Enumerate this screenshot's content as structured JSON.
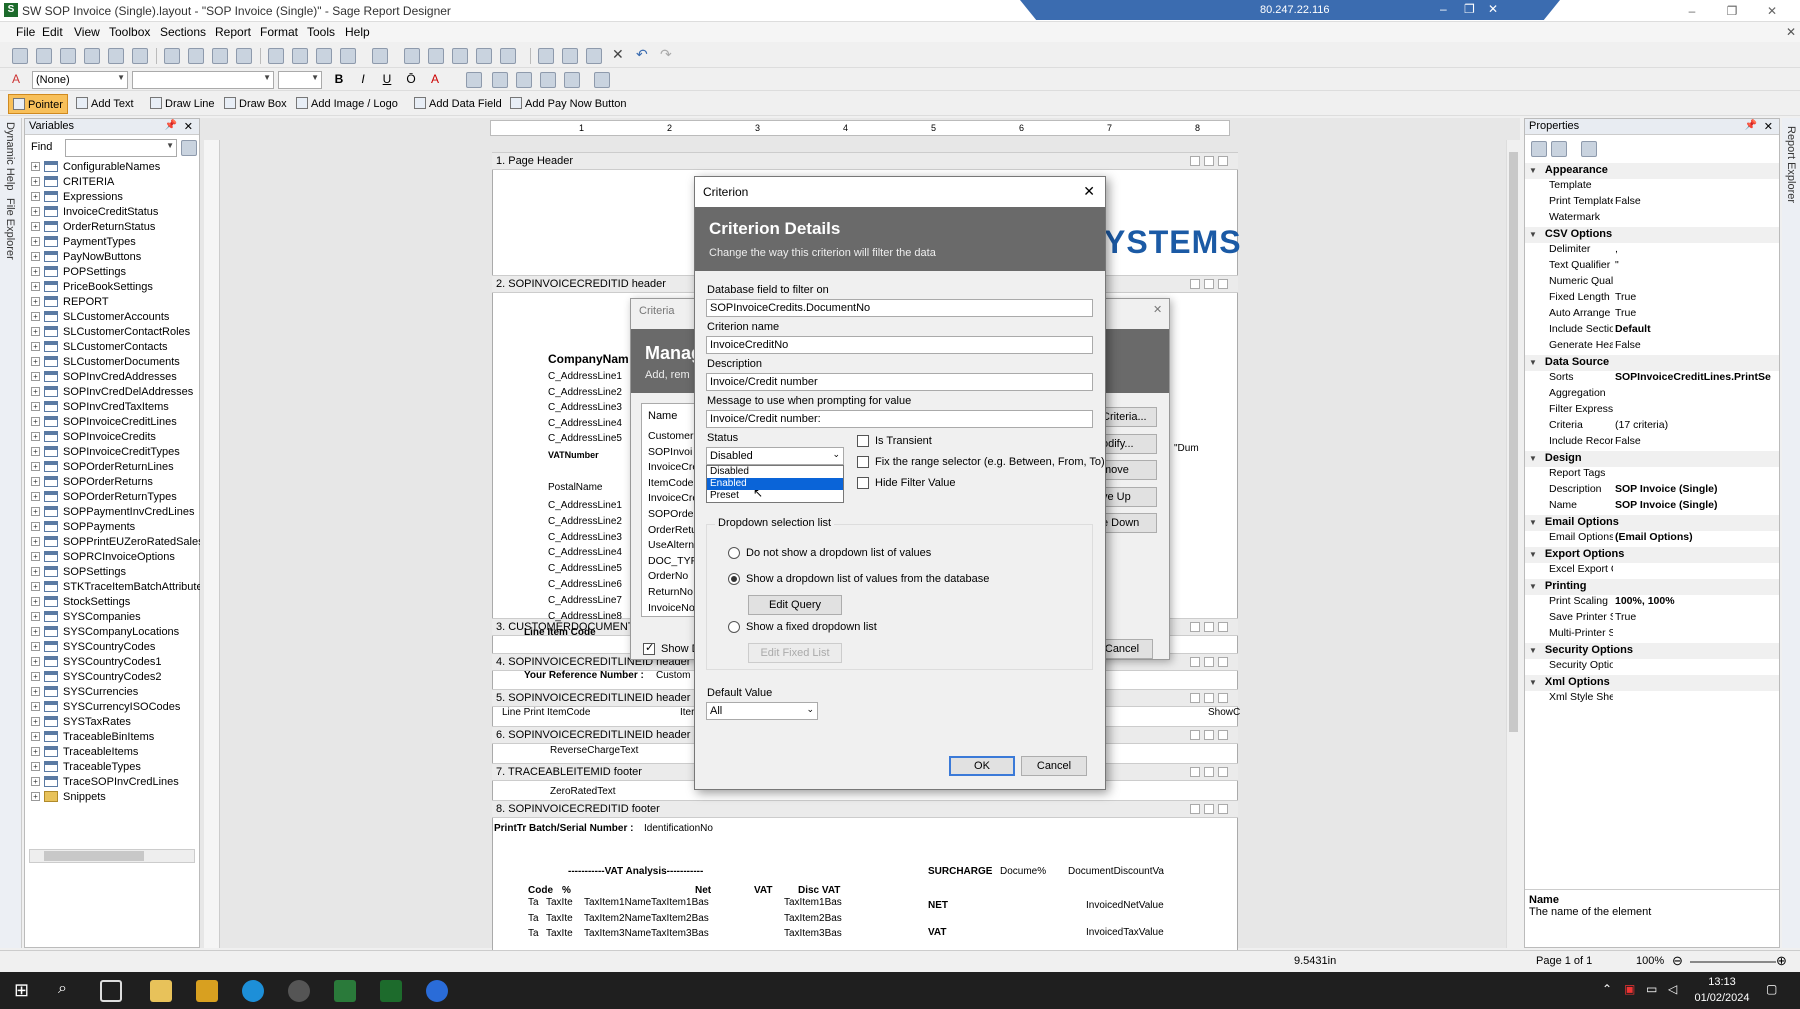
{
  "window": {
    "title": "SW SOP Invoice (Single).layout - \"SOP Invoice (Single)\" - Sage Report Designer",
    "remote_ip": "80.247.22.116"
  },
  "menu": [
    "File",
    "Edit",
    "View",
    "Toolbox",
    "Sections",
    "Report",
    "Format",
    "Tools",
    "Help"
  ],
  "format_toolbar": {
    "style_combo": "(None)",
    "bold": "B",
    "italic": "I",
    "underline": "U",
    "overline": "Ō",
    "font_color": "A"
  },
  "tool_toolbar": [
    "Pointer",
    "Add Text",
    "Draw Line",
    "Draw Box",
    "Add Image / Logo",
    "Add Data Field",
    "Add Pay Now Button"
  ],
  "variables_panel": {
    "title": "Variables",
    "find_label": "Find",
    "items": [
      "ConfigurableNames",
      "CRITERIA",
      "Expressions",
      "InvoiceCreditStatus",
      "OrderReturnStatus",
      "PaymentTypes",
      "PayNowButtons",
      "POPSettings",
      "PriceBookSettings",
      "REPORT",
      "SLCustomerAccounts",
      "SLCustomerContactRoles",
      "SLCustomerContacts",
      "SLCustomerDocuments",
      "SOPInvCredAddresses",
      "SOPInvCredDelAddresses",
      "SOPInvCredTaxItems",
      "SOPInvoiceCreditLines",
      "SOPInvoiceCredits",
      "SOPInvoiceCreditTypes",
      "SOPOrderReturnLines",
      "SOPOrderReturns",
      "SOPOrderReturnTypes",
      "SOPPaymentInvCredLines",
      "SOPPayments",
      "SOPPrintEUZeroRatedSalesO",
      "SOPRCInvoiceOptions",
      "SOPSettings",
      "STKTraceItemBatchAttribute",
      "StockSettings",
      "SYSCompanies",
      "SYSCompanyLocations",
      "SYSCountryCodes",
      "SYSCountryCodes1",
      "SYSCountryCodes2",
      "SYSCurrencies",
      "SYSCurrencyISOCodes",
      "SYSTaxRates",
      "TraceableBinItems",
      "TraceableItems",
      "TraceableTypes",
      "TraceSOPInvCredLines",
      "Snippets"
    ]
  },
  "side_tabs": {
    "left1": "Dynamic Help",
    "left2": "File Explorer",
    "right": "Report Explorer"
  },
  "ruler": [
    "1",
    "2",
    "3",
    "4",
    "5",
    "6",
    "7",
    "8"
  ],
  "report": {
    "sections": [
      "1. Page Header",
      "2. SOPINVOICECREDITID header",
      "3. CUSTOMERDOCUMENT",
      "4. SOPINVOICECREDITLINEID header",
      "5. SOPINVOICECREDITLINEID header 2",
      "6. SOPINVOICECREDITLINEID header 3",
      "7. TRACEABLEITEMID footer",
      "8. SOPINVOICECREDITID footer"
    ],
    "logo_text": "YSTEMS",
    "company_name": "CompanyNam",
    "address_lines": [
      "C_AddressLine1",
      "C_AddressLine2",
      "C_AddressLine3",
      "C_AddressLine4",
      "C_AddressLine5"
    ],
    "vat_number": "VATNumber",
    "postal_name": "PostalName",
    "postal_lines": [
      "C_AddressLine1",
      "C_AddressLine2",
      "C_AddressLine3",
      "C_AddressLine4",
      "C_AddressLine5",
      "C_AddressLine6",
      "C_AddressLine7",
      "C_AddressLine8"
    ],
    "line_item": "Line  Item Code",
    "your_ref": "Your Reference Number :",
    "your_ref_val": "Custom",
    "line_print": "Line  Print  ItemCode",
    "item_trunc": "Iter",
    "reverse_charge": "ReverseChargeText",
    "zero_rated": "ZeroRatedText",
    "batch_serial": "PrintTr Batch/Serial Number :",
    "ident": "IdentificationNo",
    "vat_analysis": "-----------VAT Analysis-----------",
    "vat_cols": [
      "Code",
      "%",
      "Net",
      "VAT",
      "Disc VAT"
    ],
    "vat_rows": [
      [
        "Ta",
        "TaxIte",
        "TaxItem1Name",
        "TaxItem1Bas",
        "TaxItem1Bas",
        "TaxItem1Bas"
      ],
      [
        "Ta",
        "TaxIte",
        "TaxItem2Name",
        "TaxItem2Bas",
        "TaxItem2Bas",
        "TaxItem2Bas"
      ],
      [
        "Ta",
        "TaxIte",
        "TaxItem3Name",
        "TaxItem3Bas",
        "TaxItem3Bas",
        "TaxItem3Bas"
      ]
    ],
    "surcharge": "SURCHARGE",
    "docume": "Docume%",
    "doc_discount": "DocumentDiscountVa",
    "net_label": "NET",
    "net_value": "InvoicedNetValue",
    "vat_label": "VAT",
    "vat_value": "InvoicedTaxValue",
    "show_c": "ShowC",
    "dum": "\"Dum"
  },
  "back_dialog": {
    "title": "Criteria",
    "heading": "Manag",
    "sub": "Add, rem",
    "name_col": "Name",
    "rows": [
      "CustomerR",
      "SOPInvoi",
      "InvoiceCre",
      "ItemCode",
      "InvoiceCre",
      "SOPOrder",
      "OrderRetu",
      "UseAltern",
      "DOC_TYP",
      "OrderNo",
      "ReturnNo",
      "InvoiceNo"
    ],
    "buttons": [
      "Criteria...",
      "odify...",
      "move",
      "ve Up",
      "e Down"
    ],
    "show_label": "Show D",
    "cancel": "Cancel"
  },
  "dialog": {
    "title": "Criterion",
    "heading": "Criterion Details",
    "subheading": "Change the way this criterion will filter the data",
    "db_field_label": "Database field to filter on",
    "db_field_value": "SOPInvoiceCredits.DocumentNo",
    "crit_name_label": "Criterion name",
    "crit_name_value": "InvoiceCreditNo",
    "desc_label": "Description",
    "desc_value": "Invoice/Credit number",
    "msg_label": "Message to use when prompting for value",
    "msg_value": "Invoice/Credit number:",
    "status_label": "Status",
    "status_value": "Disabled",
    "status_options": [
      "Disabled",
      "Enabled",
      "Preset"
    ],
    "is_transient": "Is Transient",
    "fix_range": "Fix the range selector (e.g. Between, From, To)",
    "hide_filter": "Hide Filter Value",
    "dropdown_group": "Dropdown selection list",
    "radio_none": "Do not show a dropdown list of values",
    "radio_db": "Show a dropdown list of values from the database",
    "edit_query": "Edit Query",
    "radio_fixed": "Show a fixed dropdown list",
    "edit_fixed": "Edit Fixed List",
    "default_label": "Default Value",
    "default_value": "All",
    "ok": "OK",
    "cancel": "Cancel"
  },
  "properties": {
    "title": "Properties",
    "categories": [
      {
        "name": "Appearance",
        "rows": [
          [
            "Template",
            ""
          ],
          [
            "Print Template",
            "False"
          ],
          [
            "Watermark",
            ""
          ]
        ]
      },
      {
        "name": "CSV Options",
        "rows": [
          [
            "Delimiter",
            ","
          ],
          [
            "Text Qualifier",
            "\""
          ],
          [
            "Numeric Qualif",
            ""
          ],
          [
            "Fixed Length",
            "True"
          ],
          [
            "Auto Arrange",
            "True"
          ],
          [
            "Include Sectio",
            "Default"
          ],
          [
            "Generate Hea",
            "False"
          ]
        ]
      },
      {
        "name": "Data Source",
        "rows": [
          [
            "Sorts",
            "SOPInvoiceCreditLines.PrintSe"
          ],
          [
            "Aggregation",
            ""
          ],
          [
            "Filter Expressi",
            ""
          ],
          [
            "Criteria",
            "(17 criteria)"
          ],
          [
            "Include Recor",
            "False"
          ]
        ]
      },
      {
        "name": "Design",
        "rows": [
          [
            "Report Tags",
            ""
          ],
          [
            "Description",
            "SOP Invoice (Single)"
          ],
          [
            "Name",
            "SOP Invoice (Single)"
          ]
        ]
      },
      {
        "name": "Email Options",
        "rows": [
          [
            "Email Options",
            "(Email Options)"
          ]
        ]
      },
      {
        "name": "Export Options",
        "rows": [
          [
            "Excel Export C",
            ""
          ]
        ]
      },
      {
        "name": "Printing",
        "rows": [
          [
            "Print Scaling",
            "100%, 100%"
          ],
          [
            "Save Printer S",
            "True"
          ],
          [
            "Multi-Printer S",
            ""
          ]
        ]
      },
      {
        "name": "Security Options",
        "rows": [
          [
            "Security Optio",
            ""
          ]
        ]
      },
      {
        "name": "Xml Options",
        "rows": [
          [
            "Xml Style Shee",
            ""
          ]
        ]
      }
    ],
    "help_title": "Name",
    "help_text": "The name of the element"
  },
  "statusbar": {
    "measure": "9.5431in",
    "page": "Page 1 of 1",
    "zoom": "100%"
  },
  "taskbar": {
    "time": "13:13",
    "date": "01/02/2024"
  }
}
